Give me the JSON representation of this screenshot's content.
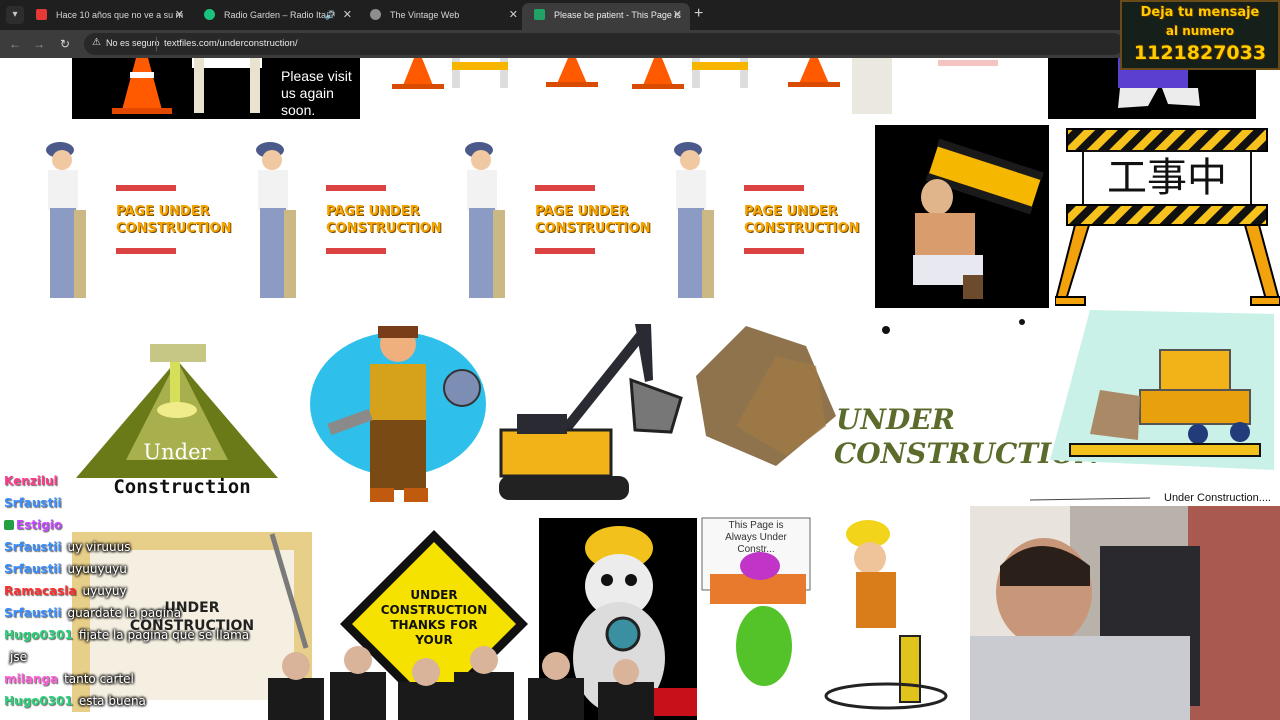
{
  "browser": {
    "tabs": [
      {
        "title": "Hace 10 años que no ve a su m",
        "favicon_color": "#e53935",
        "active": false
      },
      {
        "title": "Radio Garden – Radio Ita P",
        "favicon_color": "#19c37d",
        "active": false
      },
      {
        "title": "The Vintage Web",
        "favicon_color": "#8e8e8e",
        "active": false
      },
      {
        "title": "Please be patient - This Page is",
        "favicon_color": "#21a366",
        "active": true
      }
    ],
    "security_label": "No es seguro",
    "url": "textfiles.com/underconstruction/"
  },
  "page": {
    "visit_again": [
      "Please visit",
      "us again",
      "soon."
    ],
    "page_under_construction": [
      "PAGE UNDER",
      "CONSTRUCTION"
    ],
    "kanji_sign": "工事中",
    "under": "Under",
    "construction_word": "Construction",
    "under_wavy": "UNDER",
    "construction_wavy": "CONSTRUCTION",
    "under_construction_caption": "Under Construction....",
    "under_card": "UNDER",
    "construction_card": "CONSTRUCTION",
    "diamond_lines": [
      "UNDER",
      "CONSTRUCTION",
      "THANKS FOR",
      "YOUR"
    ],
    "always_under": [
      "This Page is",
      "Always Under",
      "Constr..."
    ]
  },
  "overlay": {
    "sign": {
      "line1": "Deja tu mensaje",
      "line2": "al numero",
      "number": "1121827033"
    },
    "chat": [
      {
        "user": "Kenzilul",
        "color": "#ff3b8b",
        "msg": ""
      },
      {
        "user": "Srfaustii",
        "color": "#3a8eff",
        "msg": ""
      },
      {
        "user": "Estigio",
        "color": "#c248ff",
        "msg": "",
        "badge": true
      },
      {
        "user": "Srfaustii",
        "color": "#3a8eff",
        "msg": "uy viruuus"
      },
      {
        "user": "Srfaustii",
        "color": "#3a8eff",
        "msg": "uyuuyuyu"
      },
      {
        "user": "Ramacasla",
        "color": "#ff2e2e",
        "msg": "uyuyuy"
      },
      {
        "user": "Srfaustii",
        "color": "#3a8eff",
        "msg": "guardate la pagina"
      },
      {
        "user": "Hugo0301",
        "color": "#2bd07a",
        "msg": "fijate la pagina que se llama"
      },
      {
        "user": "",
        "color": "#cccccc",
        "msg": "jse"
      },
      {
        "user": "milanga",
        "color": "#ff5fd7",
        "msg": "tanto cartel"
      },
      {
        "user": "Hugo0301",
        "color": "#2bd07a",
        "msg": "esta buena"
      }
    ]
  }
}
